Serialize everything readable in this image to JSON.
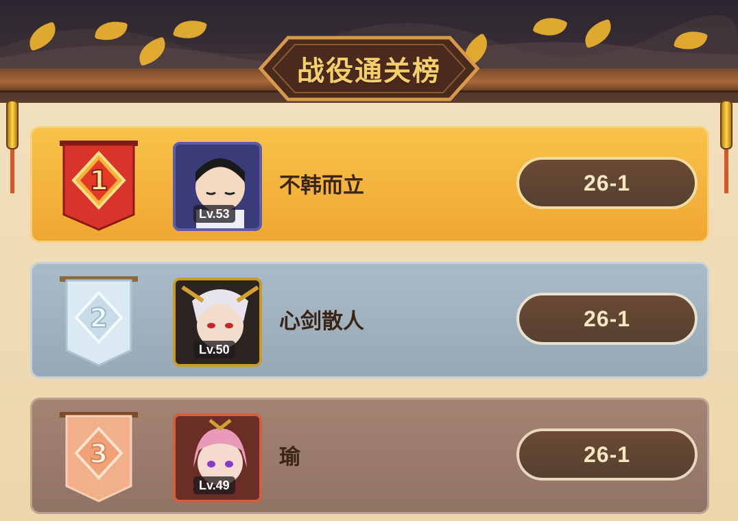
{
  "board": {
    "title": "战役通关榜"
  },
  "rows": [
    {
      "rank": "1",
      "name": "不韩而立",
      "level": "Lv.53",
      "score": "26-1",
      "tier_color": "#e2342c"
    },
    {
      "rank": "2",
      "name": "心剑散人",
      "level": "Lv.50",
      "score": "26-1",
      "tier_color": "#dbeaf2"
    },
    {
      "rank": "3",
      "name": "瑜",
      "level": "Lv.49",
      "score": "26-1",
      "tier_color": "#f2b08a"
    }
  ],
  "icons": {
    "rank_badge": "ribbon-banner-icon",
    "lantern": "lantern-icon",
    "leaf": "ginkgo-leaf-icon"
  }
}
